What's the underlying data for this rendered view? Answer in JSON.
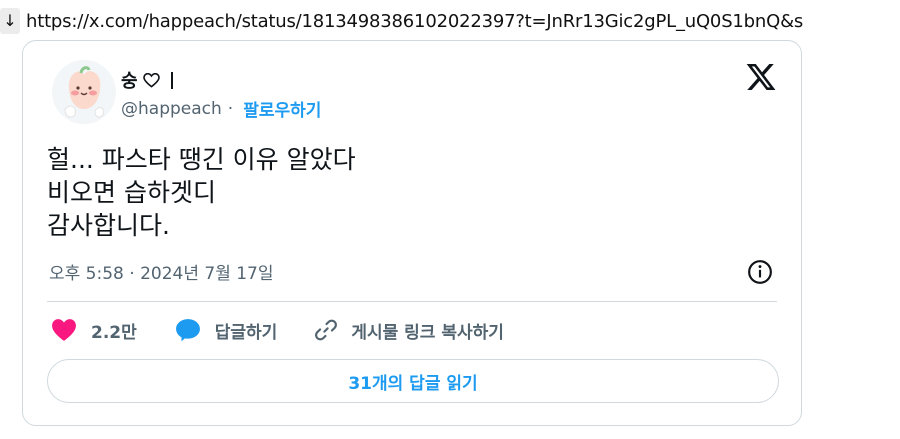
{
  "url_bar": {
    "arrow": "↓",
    "url": "https://x.com/happeach/status/1813498386102022397?t=JnRr13Gic2gPL_uQ0S1bnQ&s"
  },
  "tweet": {
    "author_name": "숭",
    "author_handle": "@happeach",
    "handle_separator": "·",
    "follow_label": "팔로우하기",
    "text_lines": [
      "헐... 파스타 땡긴 이유 알았다",
      "비오면 습하겟디",
      "감사합니다."
    ],
    "timestamp": "오후 5:58 · 2024년 7월 17일",
    "like_count": "2.2만",
    "reply_label": "답글하기",
    "copy_link_label": "게시물 링크 복사하기",
    "read_replies_label": "31개의 답글 읽기"
  },
  "colors": {
    "like": "#f91880",
    "link": "#1d9bf0",
    "muted": "#536471",
    "border": "#cfd9de"
  },
  "icons": {
    "avatar": "peach-character-avatar",
    "name_suffix": "heart-outline-icon",
    "brand": "x-logo-icon",
    "info": "info-icon",
    "like": "heart-icon",
    "reply": "speech-bubble-icon",
    "copy": "link-icon"
  }
}
